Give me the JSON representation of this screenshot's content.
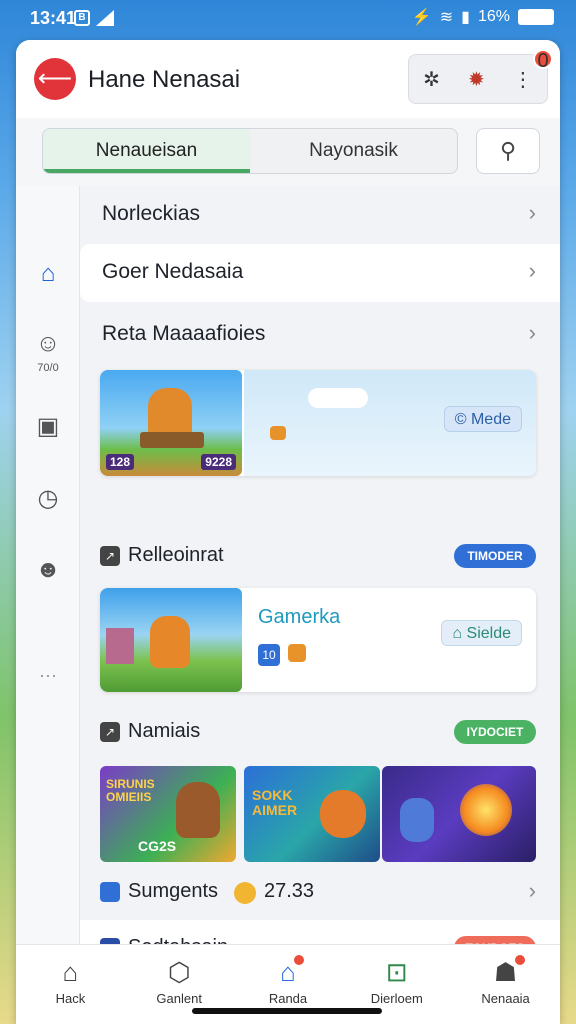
{
  "status_bar": {
    "time": "13:41",
    "badge": "B",
    "battery_text": "16%"
  },
  "header": {
    "title": "Hane Nenasai",
    "notification_count": "0",
    "actions": [
      "sparkle-icon",
      "settings-badge-icon",
      "more-icon"
    ]
  },
  "segmented_tabs": [
    {
      "label": "Nenaueisan",
      "active": true
    },
    {
      "label": "Nayonasik",
      "active": false
    }
  ],
  "menu_rows": [
    {
      "label": "Norleckias"
    },
    {
      "label": "Goer Nedasaia"
    },
    {
      "label": "Reta Maaaafioies"
    }
  ],
  "banner_1": {
    "thumb_score_left": "128",
    "thumb_score_right": "9228",
    "chip": "Mede",
    "chip_prefix": "©"
  },
  "section_1": {
    "title": "Relleoinrat",
    "pill": "TIMODER"
  },
  "banner_2": {
    "title": "Gamerka",
    "badge": "10",
    "chip": "Sielde"
  },
  "section_2": {
    "title": "Namiais",
    "pill": "IYDOCIET"
  },
  "game_tiles": [
    {
      "caption": "SIRUNIS OMIEIIS",
      "score": "CG2S"
    },
    {
      "caption": "SOKK AIMER"
    },
    {
      "caption": ""
    }
  ],
  "summary_row": {
    "label": "Sumgents",
    "value": "27.33"
  },
  "section_3": {
    "title": "Sedtahsain",
    "pill": "TOUDOES"
  },
  "sidebar": [
    {
      "icon": "store-icon",
      "label": "",
      "active": true
    },
    {
      "icon": "smiley-icon",
      "label": "70/0",
      "active": false
    },
    {
      "icon": "box-icon",
      "label": "",
      "active": false
    },
    {
      "icon": "clock-icon",
      "label": "",
      "active": false
    },
    {
      "icon": "face-icon",
      "label": "",
      "active": false
    },
    {
      "icon": "dots-icon",
      "label": "",
      "active": false
    }
  ],
  "bottom_nav": [
    {
      "label": "Hack",
      "icon": "home-icon"
    },
    {
      "label": "Ganlent",
      "icon": "shield-icon"
    },
    {
      "label": "Randa",
      "icon": "house-icon",
      "active": true
    },
    {
      "label": "Dierloem",
      "icon": "bag-icon"
    },
    {
      "label": "Nenaaia",
      "icon": "profile-icon"
    }
  ],
  "colors": {
    "accent_red": "#e0343a",
    "accent_green": "#47a763",
    "accent_blue": "#2a6fdb",
    "pill_blue": "#2f6fd6",
    "pill_green": "#4bb264",
    "pill_coral": "#ef6b5a"
  }
}
